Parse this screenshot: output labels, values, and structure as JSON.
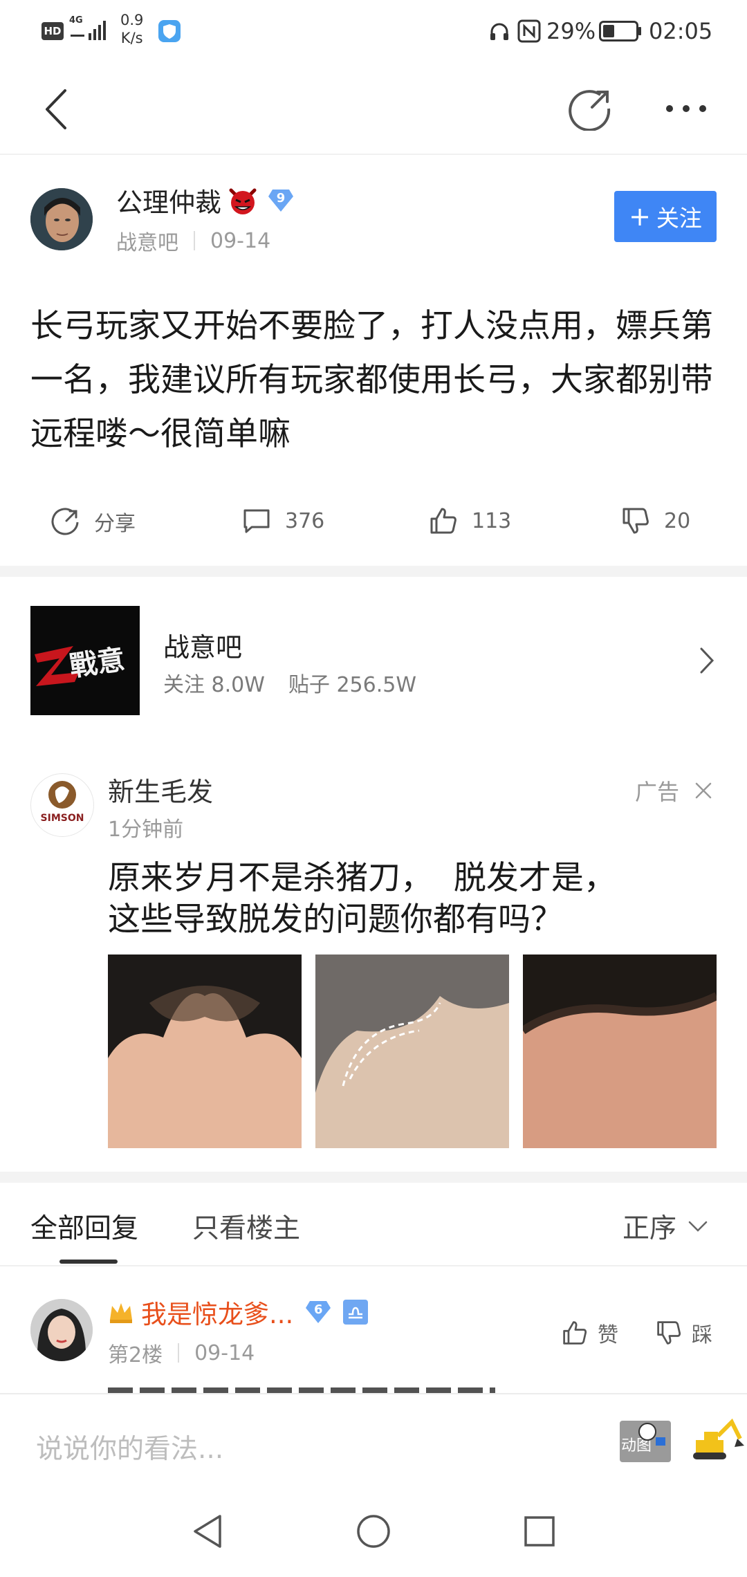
{
  "status_bar": {
    "hd": "HD",
    "network": "4G",
    "speed_value": "0.9",
    "speed_unit": "K/s",
    "battery_percent": "29%",
    "time": "02:05"
  },
  "post": {
    "author": "公理仲裁",
    "level": "9",
    "forum": "战意吧",
    "date": "09-14",
    "follow_label": "关注",
    "content": "长弓玩家又开始不要脸了，打人没点用，嫖兵第一名，我建议所有玩家都使用长弓，大家都别带远程喽～很简单嘛",
    "actions": {
      "share": "分享",
      "comments": "376",
      "likes": "113",
      "dislikes": "20"
    }
  },
  "forum_card": {
    "name": "战意吧",
    "followers": "关注 8.0W",
    "posts": "贴子 256.5W",
    "logo_text": "戰意"
  },
  "ad": {
    "advertiser": "新生毛发",
    "time": "1分钟前",
    "ad_label": "广告",
    "text_line1": "原来岁月不是杀猪刀，  脱发才是，",
    "text_line2": "这些导致脱发的问题你都有吗？",
    "logo_text": "SIMSON"
  },
  "reply_tabs": {
    "all": "全部回复",
    "owner_only": "只看楼主",
    "sort": "正序"
  },
  "reply": {
    "author": "我是惊龙爹...",
    "level": "6",
    "floor": "第2楼",
    "date": "09-14",
    "like_label": "赞",
    "dislike_label": "踩"
  },
  "comment_bar": {
    "placeholder": "说说你的看法...",
    "sticker_label": "动图"
  },
  "colors": {
    "accent": "#3f86f5",
    "reply_name": "#e84f1b",
    "muted": "#9a9a9a"
  }
}
